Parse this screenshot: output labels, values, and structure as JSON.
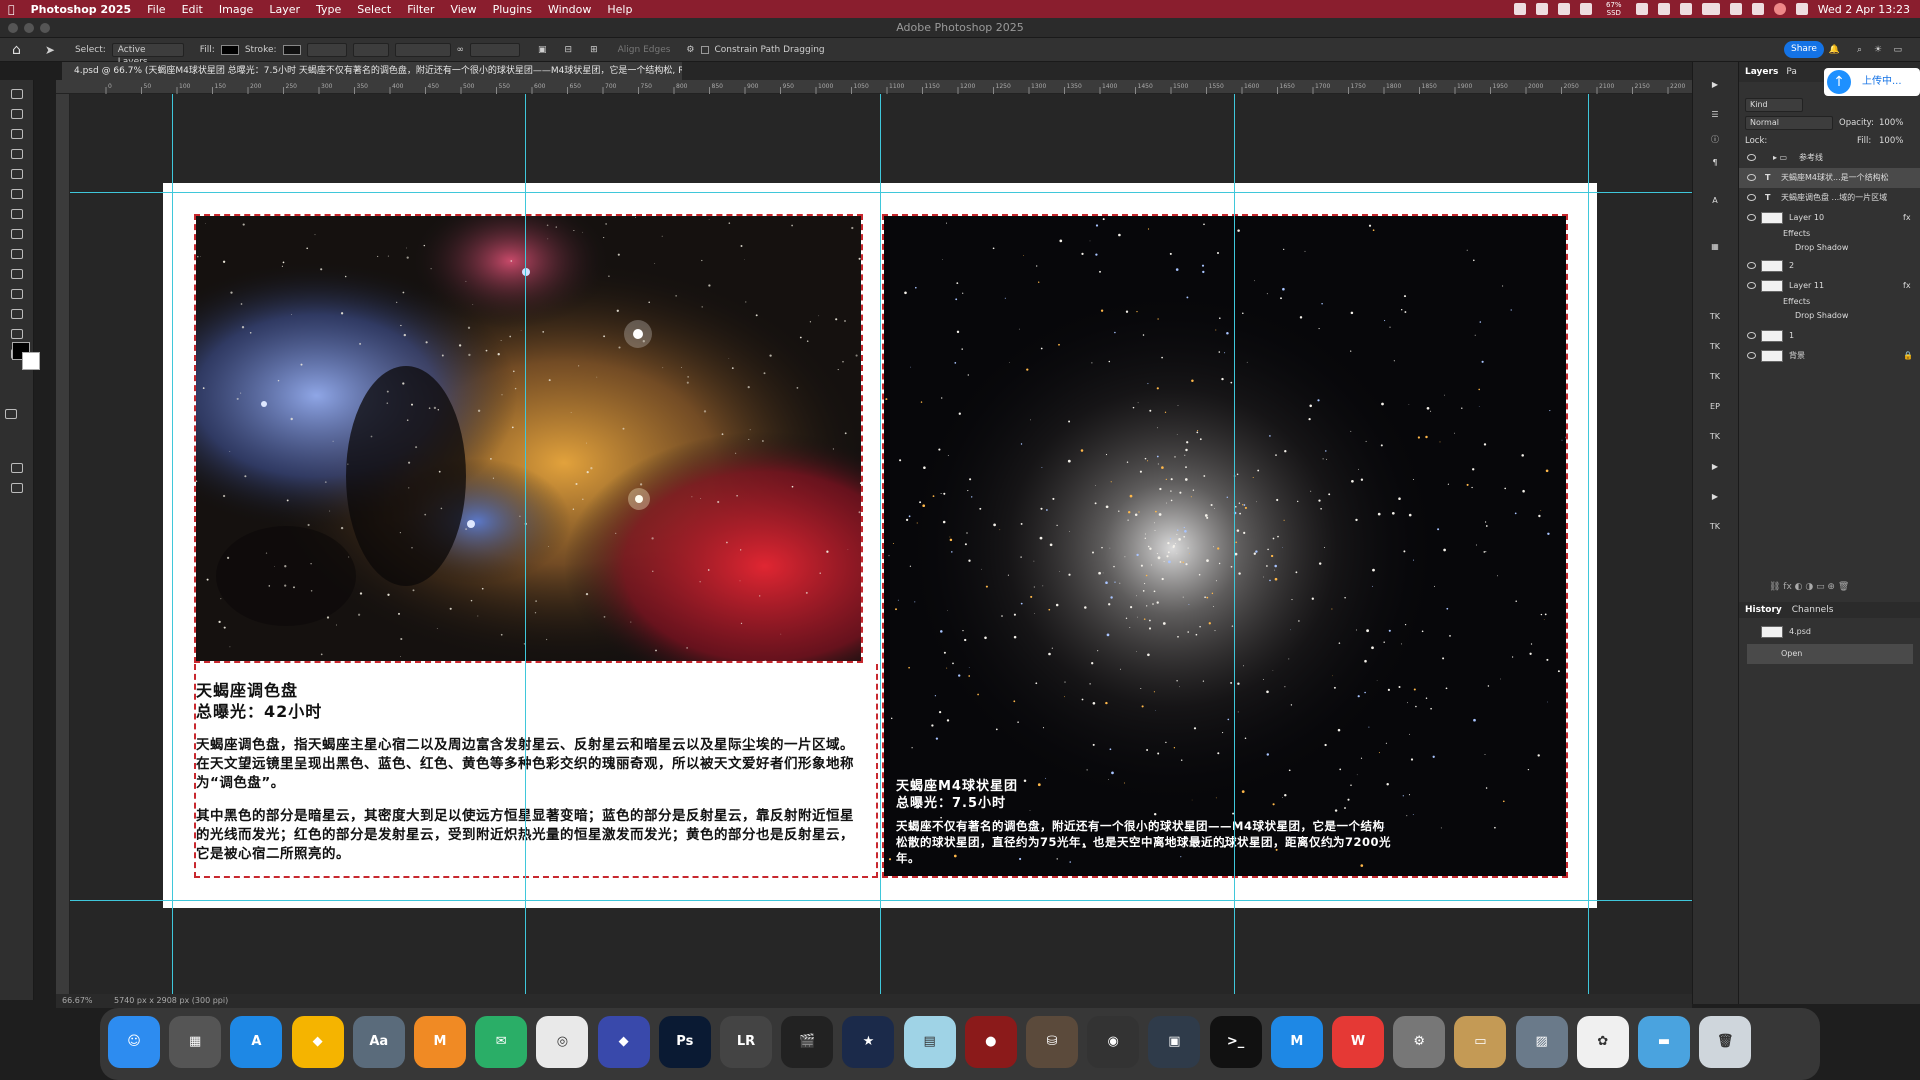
{
  "menubar": {
    "app": "Photoshop 2025",
    "items": [
      "File",
      "Edit",
      "Image",
      "Layer",
      "Type",
      "Select",
      "Filter",
      "View",
      "Plugins",
      "Window",
      "Help"
    ],
    "datetime": "Wed 2 Apr 13:23",
    "ssd": "67% SSD"
  },
  "window_title": "Adobe Photoshop 2025",
  "options": {
    "select_label": "Select:",
    "select_value": "Active Layers",
    "fill_label": "Fill:",
    "stroke_label": "Stroke:",
    "align_edges": "Align Edges",
    "constrain": "Constrain Path Dragging",
    "share": "Share"
  },
  "doc_tab": "4.psd @ 66.7% (天蝎座M4球状星团 总曝光：7.5小时  天蝎座不仅有著名的调色盘，附近还有一个很小的球状星团——M4球状星团，它是一个结构松, RGB/8)",
  "ruler_ticks": [
    "0",
    "50",
    "100",
    "150",
    "200",
    "250",
    "300",
    "350",
    "400",
    "450",
    "500",
    "550",
    "600",
    "650",
    "700",
    "750",
    "800",
    "850",
    "900",
    "950",
    "1000",
    "1050",
    "1100",
    "1150",
    "1200",
    "1250",
    "1300",
    "1350",
    "1400",
    "1450",
    "1500",
    "1550",
    "1600",
    "1650",
    "1700",
    "1750",
    "1800",
    "1850",
    "1900",
    "1950",
    "2000",
    "2050",
    "2100",
    "2150",
    "2200"
  ],
  "canvas": {
    "left_title": "天蝎座调色盘",
    "left_exposure": "总曝光：42小时",
    "left_p1": "天蝎座调色盘，指天蝎座主星心宿二以及周边富含发射星云、反射星云和暗星云以及星际尘埃的一片区域。在天文望远镜里呈现出黑色、蓝色、红色、黄色等多种色彩交织的瑰丽奇观，所以被天文爱好者们形象地称为“调色盘”。",
    "left_p2": "其中黑色的部分是暗星云，其密度大到足以使远方恒星显著变暗；蓝色的部分是反射星云，靠反射附近恒星的光线而发光；红色的部分是发射星云，受到附近炽热光量的恒星激发而发光；黄色的部分也是反射星云，它是被心宿二所照亮的。",
    "right_title": "天蝎座M4球状星团",
    "right_exposure": "总曝光：7.5小时",
    "right_p": "天蝎座不仅有著名的调色盘，附近还有一个很小的球状星团——M4球状星团，它是一个结构松散的球状星团，直径约为75光年，也是天空中离地球最近的球状星团，距离仅约为7200光年。"
  },
  "status": {
    "zoom": "66.67%",
    "doc_size": "5740 px x 2908 px (300 ppi)"
  },
  "panel": {
    "tabs": [
      "Layers",
      "Pa"
    ],
    "upload": "上传中...",
    "kind": "Kind",
    "blend": "Normal",
    "opacity_label": "Opacity:",
    "opacity": "100%",
    "lock_label": "Lock:",
    "fill_label": "Fill:",
    "fill": "100%",
    "layers": [
      {
        "name": "参考线",
        "type": "group"
      },
      {
        "name": "天蝎座M4球状...是一个结构松",
        "type": "text"
      },
      {
        "name": "天蝎座调色盘 ...域的一片区域",
        "type": "text"
      },
      {
        "name": "Layer 10",
        "type": "image",
        "fx": "fx"
      },
      {
        "name": "Effects",
        "type": "effects"
      },
      {
        "name": "Drop Shadow",
        "type": "effect"
      },
      {
        "name": "2",
        "type": "image"
      },
      {
        "name": "Layer 11",
        "type": "image",
        "fx": "fx"
      },
      {
        "name": "Effects",
        "type": "effects"
      },
      {
        "name": "Drop Shadow",
        "type": "effect"
      },
      {
        "name": "1",
        "type": "image"
      },
      {
        "name": "背景",
        "type": "bg"
      }
    ],
    "history_tabs": [
      "History",
      "Channels"
    ],
    "history": [
      "4.psd",
      "Open"
    ]
  },
  "dock": [
    {
      "name": "Finder",
      "color": "#2d8cf0",
      "glyph": "☺"
    },
    {
      "name": "Launchpad",
      "color": "#555",
      "glyph": "▦"
    },
    {
      "name": "App Store",
      "color": "#1e88e5",
      "glyph": "A"
    },
    {
      "name": "Notes",
      "color": "#f5b400",
      "glyph": "◆"
    },
    {
      "name": "Dictionary",
      "color": "#5a6b7b",
      "glyph": "Aa"
    },
    {
      "name": "MindNode",
      "color": "#f08a24",
      "glyph": "M"
    },
    {
      "name": "WeChat",
      "color": "#2aae67",
      "glyph": "✉"
    },
    {
      "name": "Chrome",
      "color": "#e9e9e9",
      "glyph": "◎"
    },
    {
      "name": "Prism",
      "color": "#3949ab",
      "glyph": "◆"
    },
    {
      "name": "Photoshop",
      "color": "#0a1a33",
      "glyph": "Ps"
    },
    {
      "name": "LRTimelapse",
      "color": "#444",
      "glyph": "LR"
    },
    {
      "name": "Final Cut Pro",
      "color": "#222",
      "glyph": "🎬"
    },
    {
      "name": "Stellarium",
      "color": "#1b2a4a",
      "glyph": "★"
    },
    {
      "name": "Files",
      "color": "#9fd3e6",
      "glyph": "▤"
    },
    {
      "name": "Sphere",
      "color": "#8b1a1a",
      "glyph": "●"
    },
    {
      "name": "Disk",
      "color": "#5b4a3b",
      "glyph": "⛁"
    },
    {
      "name": "Camera",
      "color": "#333",
      "glyph": "◉"
    },
    {
      "name": "Control",
      "color": "#2f3b4a",
      "glyph": "▣"
    },
    {
      "name": "Terminal",
      "color": "#111",
      "glyph": ">_"
    },
    {
      "name": "Cloud",
      "color": "#1e88e5",
      "glyph": "M"
    },
    {
      "name": "WPS",
      "color": "#e53935",
      "glyph": "W"
    },
    {
      "name": "Settings",
      "color": "#777",
      "glyph": "⚙"
    },
    {
      "name": "Archive",
      "color": "#c49a55",
      "glyph": "▭"
    },
    {
      "name": "Preview",
      "color": "#6a7a8a",
      "glyph": "▨"
    },
    {
      "name": "Nodes",
      "color": "#f0f0f0",
      "glyph": "✿"
    },
    {
      "name": "Folder",
      "color": "#4aa3df",
      "glyph": "▬"
    },
    {
      "name": "Trash",
      "color": "#cfd6dc",
      "glyph": "🗑"
    }
  ]
}
